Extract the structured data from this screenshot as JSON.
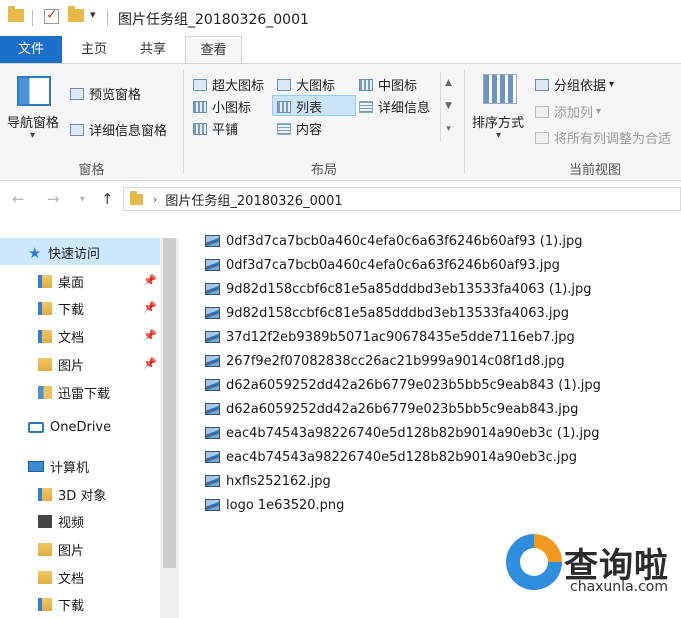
{
  "window": {
    "title": "图片任务组_20180326_0001"
  },
  "ribbon_tabs": {
    "file": "文件",
    "home": "主页",
    "share": "共享",
    "view": "查看"
  },
  "ribbon": {
    "pane_group": {
      "nav_pane": "导航窗格",
      "preview_pane": "预览窗格",
      "details_pane": "详细信息窗格",
      "label": "窗格"
    },
    "layout_group": {
      "extra_large": "超大图标",
      "large": "大图标",
      "medium": "中图标",
      "small": "小图标",
      "list": "列表",
      "details": "详细信息",
      "tiles": "平铺",
      "content": "内容",
      "label": "布局"
    },
    "current_view_group": {
      "sort_by": "排序方式",
      "group_by": "分组依据",
      "add_column": "添加列",
      "fit_columns": "将所有列调整为合适",
      "label": "当前视图"
    }
  },
  "address": {
    "path": "图片任务组_20180326_0001"
  },
  "nav_pane": {
    "quick_access": "快速访问",
    "items": [
      {
        "label": "桌面"
      },
      {
        "label": "下载"
      },
      {
        "label": "文档"
      },
      {
        "label": "图片"
      },
      {
        "label": "迅雷下载"
      }
    ],
    "onedrive": "OneDrive",
    "this_pc": "计算机",
    "pc_items": [
      {
        "label": "3D 对象"
      },
      {
        "label": "视频"
      },
      {
        "label": "图片"
      },
      {
        "label": "文档"
      },
      {
        "label": "下载"
      }
    ]
  },
  "files": [
    {
      "name": "0df3d7ca7bcb0a460c4efa0c6a63f6246b60af93 (1).jpg"
    },
    {
      "name": "0df3d7ca7bcb0a460c4efa0c6a63f6246b60af93.jpg"
    },
    {
      "name": "9d82d158ccbf6c81e5a85dddbd3eb13533fa4063 (1).jpg"
    },
    {
      "name": "9d82d158ccbf6c81e5a85dddbd3eb13533fa4063.jpg"
    },
    {
      "name": "37d12f2eb9389b5071ac90678435e5dde7116eb7.jpg"
    },
    {
      "name": "267f9e2f07082838cc26ac21b999a9014c08f1d8.jpg"
    },
    {
      "name": "d62a6059252dd42a26b6779e023b5bb5c9eab843 (1).jpg"
    },
    {
      "name": "d62a6059252dd42a26b6779e023b5bb5c9eab843.jpg"
    },
    {
      "name": "eac4b74543a98226740e5d128b82b9014a90eb3c (1).jpg"
    },
    {
      "name": "eac4b74543a98226740e5d128b82b9014a90eb3c.jpg"
    },
    {
      "name": "hxfls252162.jpg"
    },
    {
      "name": "logo 1e63520.png"
    }
  ],
  "watermark": {
    "text": "查询啦",
    "url": "chaxunla.com"
  }
}
